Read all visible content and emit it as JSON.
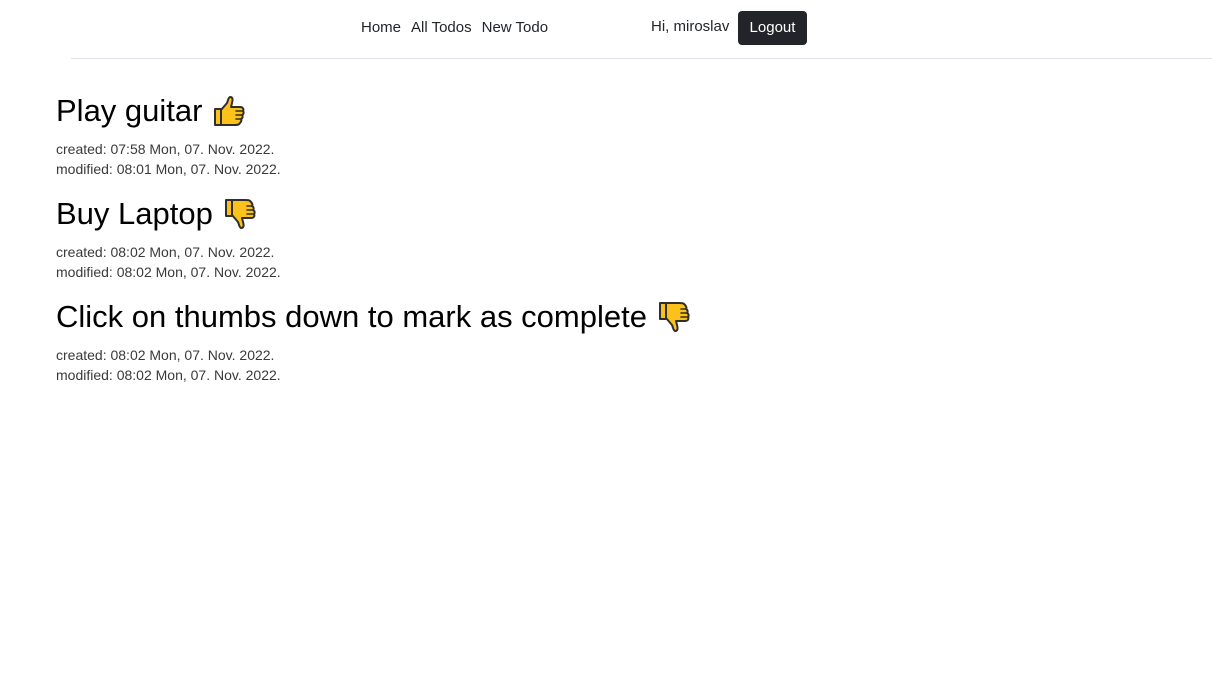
{
  "nav": {
    "links": [
      "Home",
      "All Todos",
      "New Todo"
    ],
    "greeting": "Hi, miroslav",
    "logout_label": "Logout"
  },
  "todos": [
    {
      "title": "Play guitar",
      "status_icon": "thumbs-up-icon",
      "completed": true,
      "created": "created: 07:58 Mon, 07. Nov. 2022.",
      "modified": "modified: 08:01 Mon, 07. Nov. 2022."
    },
    {
      "title": "Buy Laptop",
      "status_icon": "thumbs-down-icon",
      "completed": false,
      "created": "created: 08:02 Mon, 07. Nov. 2022.",
      "modified": "modified: 08:02 Mon, 07. Nov. 2022."
    },
    {
      "title": "Click on thumbs down to mark as complete",
      "status_icon": "thumbs-down-icon",
      "completed": false,
      "created": "created: 08:02 Mon, 07. Nov. 2022.",
      "modified": "modified: 08:02 Mon, 07. Nov. 2022."
    }
  ],
  "colors": {
    "text": "#212529",
    "button_bg": "#212529",
    "button_text": "#ffffff",
    "divider": "#dee2e6",
    "thumb_fill": "#fcc21b",
    "thumb_stroke": "#2f2f2f"
  }
}
